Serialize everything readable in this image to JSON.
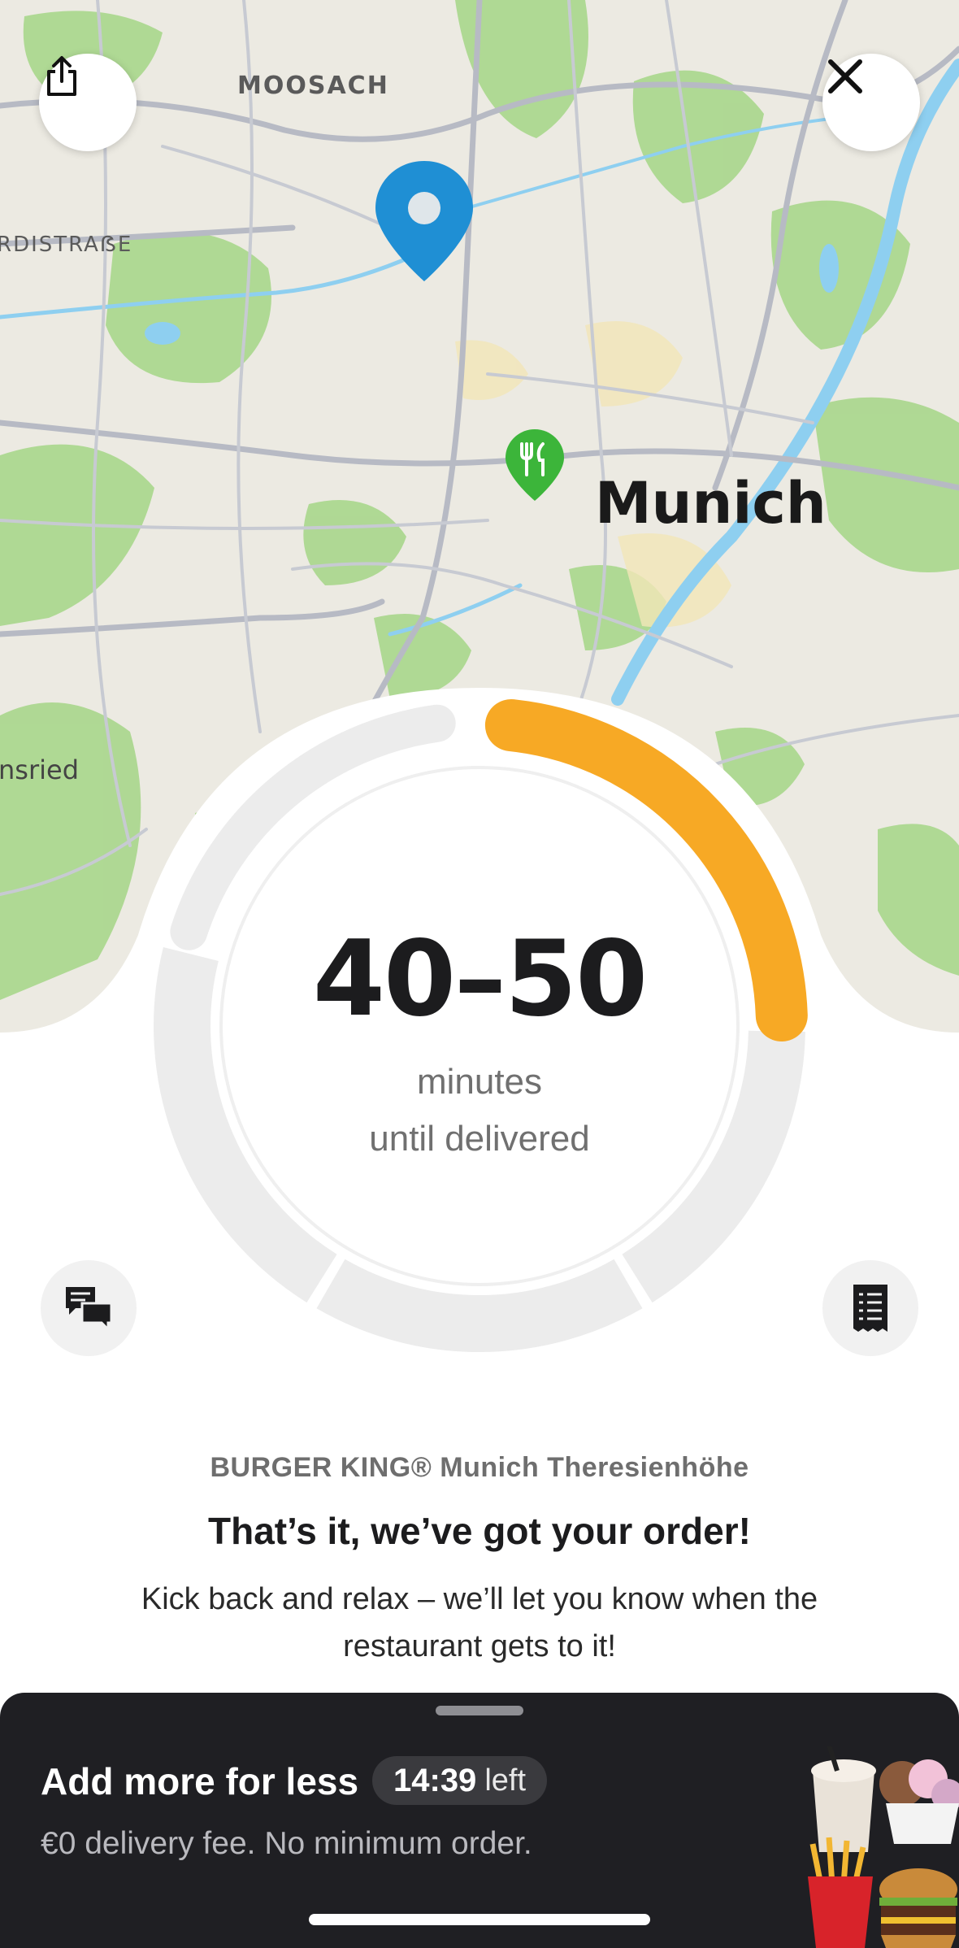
{
  "map": {
    "labels": {
      "district_moosach": "MOOSACH",
      "street_fragment": "RDISTRAẞE",
      "city": "Munich",
      "district_fragment": "nsried"
    },
    "colors": {
      "water": "#8ecff0",
      "park": "#a8d98a",
      "land": "#eeece4",
      "road": "#b9bcc6",
      "pin_blue": "#1f8fd4",
      "pin_green": "#3cb53a"
    },
    "share_icon": "share-icon",
    "close_icon": "close-icon"
  },
  "timer": {
    "eta": "40–50",
    "line1": "minutes",
    "line2": "until delivered",
    "progress_color": "#f7a925",
    "progress_segment": 1,
    "segments": 4
  },
  "actions": {
    "chat_icon": "chat-icon",
    "receipt_icon": "receipt-icon"
  },
  "order": {
    "restaurant": "BURGER KING® Munich Theresienhöhe",
    "headline": "That’s it, we’ve got your order!",
    "message": "Kick back and relax – we’ll let you know when the restaurant gets to it!"
  },
  "promo": {
    "title": "Add more for less",
    "timer": "14:39",
    "timer_suffix": "left",
    "subtitle": "€0 delivery fee. No minimum order.",
    "image_icon": "food-collage-icon"
  }
}
